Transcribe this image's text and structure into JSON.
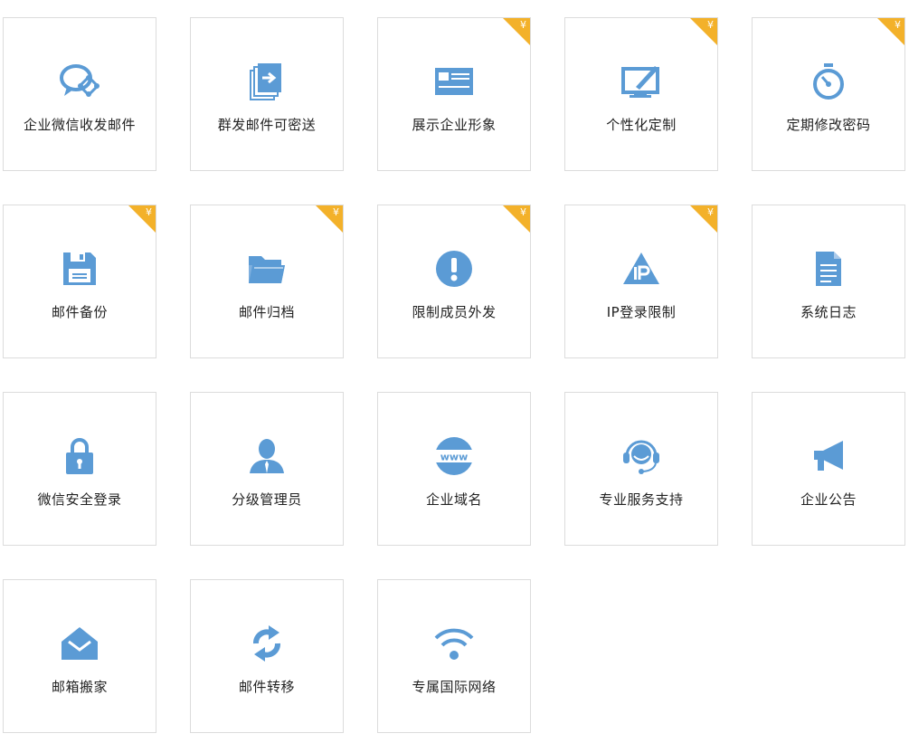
{
  "colors": {
    "icon": "#5b9bd5",
    "badge": "#f3b12a",
    "border": "#dcdcdc",
    "text": "#222222"
  },
  "badge_text": "¥",
  "tiles": [
    {
      "label": "企业微信收发邮件",
      "icon": "wechat-mail-icon",
      "paid": false
    },
    {
      "label": "群发邮件可密送",
      "icon": "bulk-send-icon",
      "paid": false
    },
    {
      "label": "展示企业形象",
      "icon": "business-card-icon",
      "paid": true
    },
    {
      "label": "个性化定制",
      "icon": "monitor-pen-icon",
      "paid": true
    },
    {
      "label": "定期修改密码",
      "icon": "stopwatch-icon",
      "paid": true
    },
    {
      "label": "邮件备份",
      "icon": "floppy-disk-icon",
      "paid": true
    },
    {
      "label": "邮件归档",
      "icon": "folder-icon",
      "paid": true
    },
    {
      "label": "限制成员外发",
      "icon": "alert-icon",
      "paid": true
    },
    {
      "label": "IP登录限制",
      "icon": "ip-triangle-icon",
      "paid": true
    },
    {
      "label": "系统日志",
      "icon": "document-icon",
      "paid": false
    },
    {
      "label": "微信安全登录",
      "icon": "lock-icon",
      "paid": false
    },
    {
      "label": "分级管理员",
      "icon": "admin-user-icon",
      "paid": false
    },
    {
      "label": "企业域名",
      "icon": "www-globe-icon",
      "paid": false
    },
    {
      "label": "专业服务支持",
      "icon": "headset-icon",
      "paid": false
    },
    {
      "label": "企业公告",
      "icon": "megaphone-icon",
      "paid": false
    },
    {
      "label": "邮箱搬家",
      "icon": "mail-house-icon",
      "paid": false
    },
    {
      "label": "邮件转移",
      "icon": "sync-arrows-icon",
      "paid": false
    },
    {
      "label": "专属国际网络",
      "icon": "wifi-icon",
      "paid": false
    }
  ]
}
